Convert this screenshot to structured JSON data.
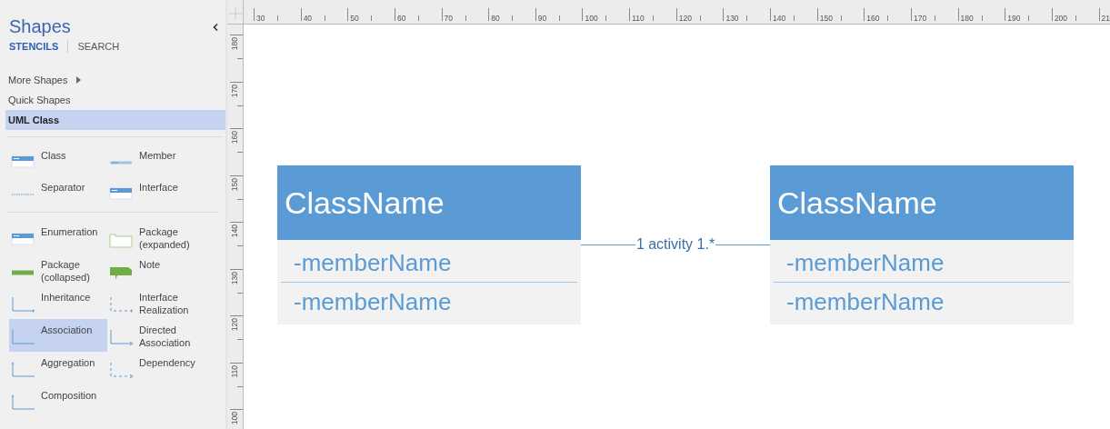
{
  "panel": {
    "title": "Shapes",
    "tabs": [
      {
        "label": "STENCILS",
        "selected": true
      },
      {
        "label": "SEARCH",
        "selected": false
      }
    ],
    "nav": [
      {
        "label": "More Shapes",
        "selected": false,
        "submenu": true
      },
      {
        "label": "Quick Shapes",
        "selected": false,
        "submenu": false
      },
      {
        "label": "UML Class",
        "selected": true,
        "submenu": false
      }
    ],
    "stencil_groups": [
      {
        "items": [
          {
            "kind": "class",
            "label": "Class",
            "selected": false
          },
          {
            "kind": "member",
            "label": "Member",
            "selected": false
          },
          {
            "kind": "separator",
            "label": "Separator",
            "selected": false
          },
          {
            "kind": "interface",
            "label": "Interface",
            "selected": false
          }
        ]
      },
      {
        "items": [
          {
            "kind": "enumeration",
            "label": "Enumeration",
            "selected": false
          },
          {
            "kind": "package-expanded",
            "label": "Package (expanded)",
            "selected": false
          },
          {
            "kind": "package-collapsed",
            "label": "Package (collapsed)",
            "selected": false
          },
          {
            "kind": "note",
            "label": "Note",
            "selected": false
          },
          {
            "kind": "inheritance",
            "label": "Inheritance",
            "selected": false
          },
          {
            "kind": "interface-realization",
            "label": "Interface Realization",
            "selected": false
          },
          {
            "kind": "association",
            "label": "Association",
            "selected": true
          },
          {
            "kind": "directed-association",
            "label": "Directed Association",
            "selected": false
          },
          {
            "kind": "aggregation",
            "label": "Aggregation",
            "selected": false
          },
          {
            "kind": "dependency",
            "label": "Dependency",
            "selected": false
          },
          {
            "kind": "composition",
            "label": "Composition",
            "selected": false
          }
        ]
      }
    ]
  },
  "top_ruler": [
    "30",
    "40",
    "50",
    "60",
    "70",
    "80",
    "90",
    "100",
    "110",
    "120",
    "130",
    "140",
    "150",
    "160",
    "170",
    "180",
    "190",
    "200",
    "21"
  ],
  "left_ruler": [
    "180",
    "170",
    "160",
    "150",
    "140",
    "130",
    "120",
    "110",
    "100"
  ],
  "diagram": {
    "classes": [
      {
        "name": "ClassName",
        "members": [
          "-memberName",
          "-memberName"
        ]
      },
      {
        "name": "ClassName",
        "members": [
          "-memberName",
          "-memberName"
        ]
      }
    ],
    "association": {
      "label": "1 activity 1.*"
    }
  }
}
